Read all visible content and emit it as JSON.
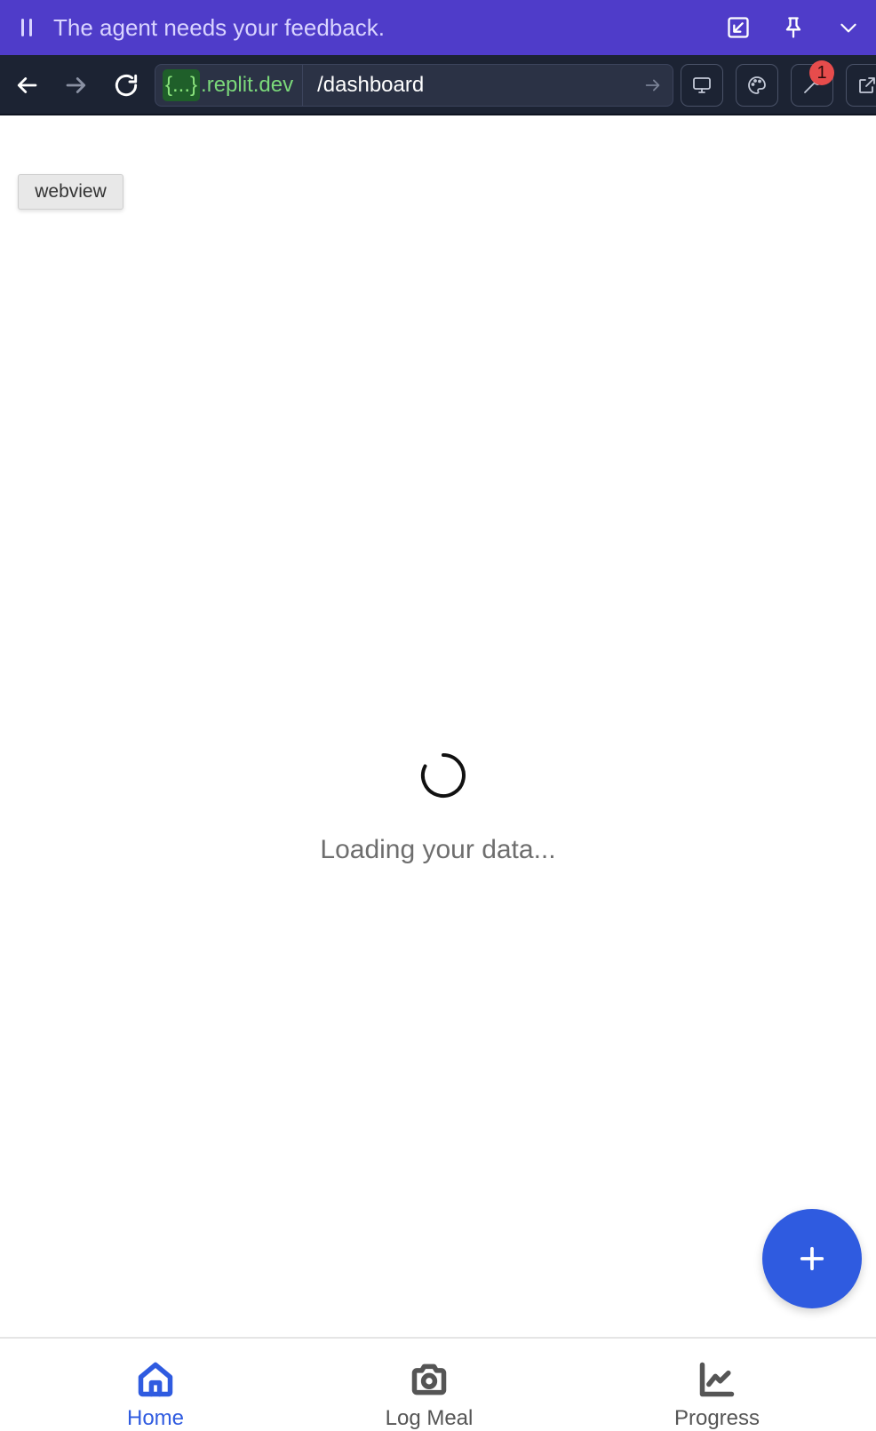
{
  "agent_bar": {
    "message": "The agent needs your feedback.",
    "actions": [
      "popout-icon",
      "pin-icon",
      "chevron-down-icon"
    ]
  },
  "browser": {
    "url_token": "{...}",
    "url_host": ".replit.dev",
    "url_path": "/dashboard",
    "devtools_badge": "1"
  },
  "content": {
    "tag": "webview",
    "loading_text": "Loading your data..."
  },
  "bottom_nav": {
    "items": [
      {
        "label": "Home",
        "icon": "home-icon",
        "active": true
      },
      {
        "label": "Log Meal",
        "icon": "camera-icon",
        "active": false
      },
      {
        "label": "Progress",
        "icon": "chart-icon",
        "active": false
      }
    ]
  },
  "colors": {
    "agent_bar": "#4f3cc9",
    "toolbar": "#1c2333",
    "accent": "#2f5be0",
    "inactive": "#555555"
  }
}
